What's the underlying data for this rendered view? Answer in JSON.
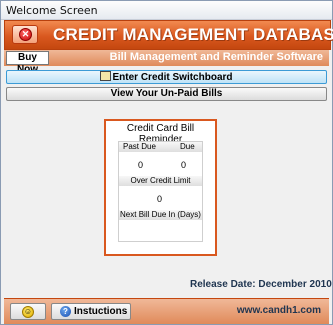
{
  "window": {
    "title": "Welcome Screen"
  },
  "header": {
    "title": "CREDIT MANAGEMENT DATABASE",
    "subtitle": "Bill Management and Reminder Software",
    "buy_now_label": "Buy Now",
    "close_icon": "close-icon"
  },
  "buttons": {
    "switchboard_label": "Enter Credit Switchboard",
    "unpaid_label": "View Your Un-Paid Bills"
  },
  "reminder": {
    "title": "Credit Card Bill Reminder",
    "past_due_label": "Past Due",
    "due_label": "Due",
    "past_due_value": "0",
    "due_value": "0",
    "over_limit_label": "Over Credit Limit",
    "over_limit_value": "0",
    "next_bill_label": "Next Bill Due In (Days)",
    "next_bill_value": ""
  },
  "release": "Release Date: December 2010",
  "footer": {
    "instructions_label": "Instuctions",
    "website": "www.candh1.com"
  },
  "colors": {
    "accent": "#d9581f",
    "text_dark": "#1f3550"
  }
}
